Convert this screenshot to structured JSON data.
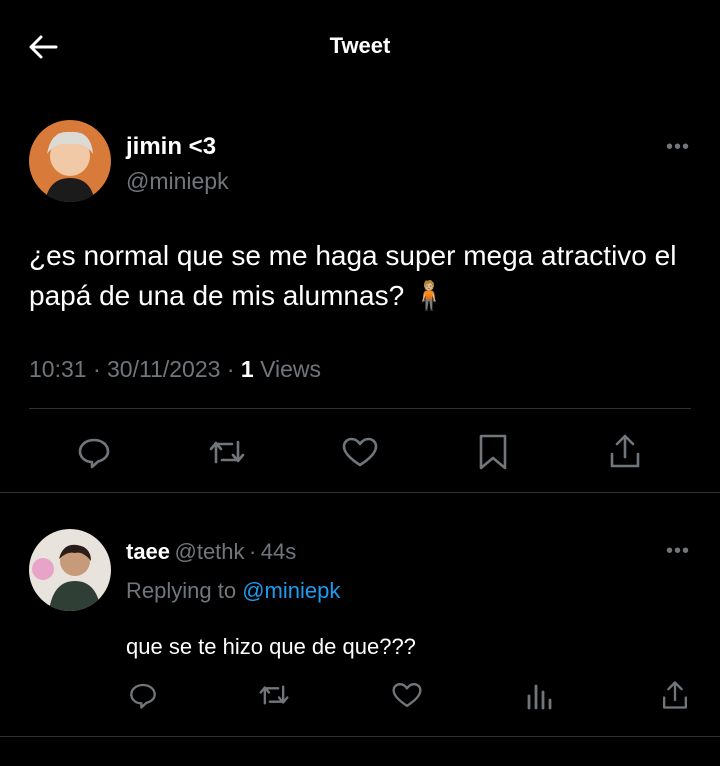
{
  "header": {
    "title": "Tweet"
  },
  "tweet": {
    "author_name": "jimin <3",
    "author_handle": "@miniepk",
    "text": "¿es normal que se me haga super mega atractivo el papá de una de mis alumnas? 🧍🏼",
    "time": "10:31",
    "date": "30/11/2023",
    "views_count": "1",
    "views_label": "Views",
    "actions": [
      "reply-icon",
      "retweet-icon",
      "like-icon",
      "bookmark-icon",
      "share-icon"
    ],
    "more_label": "•••"
  },
  "reply": {
    "author_name": "taee",
    "author_handle": "@tethk",
    "age": "44s",
    "replying_prefix": "Replying to",
    "replying_to": "@miniepk",
    "text": "que se te hizo que de que???",
    "actions": [
      "reply-icon",
      "retweet-icon",
      "like-icon",
      "views-icon",
      "share-icon"
    ],
    "more_label": "•••"
  },
  "colors": {
    "background": "#000000",
    "muted": "#71767b",
    "link": "#1d9bf0",
    "divider": "#2f3336"
  }
}
